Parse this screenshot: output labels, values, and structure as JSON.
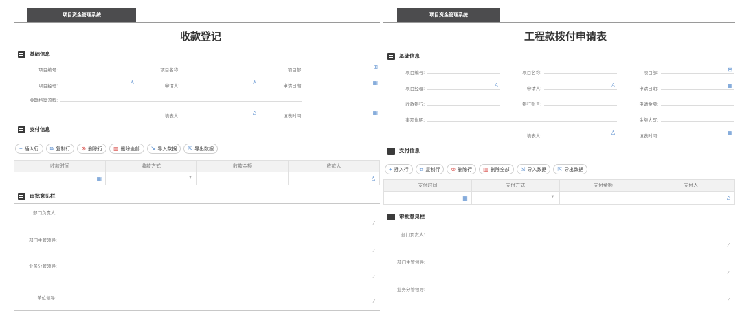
{
  "left": {
    "system_tab": "项目资金管理系统",
    "title": "收款登记",
    "basic_section": "基础信息",
    "fields": {
      "project_no": "项目编号:",
      "project_name": "项目名称:",
      "project_dept": "项目部:",
      "project_manager": "项目经理:",
      "applicant": "申请人:",
      "apply_date": "申请日期:",
      "related_flow": "关联档案流程:",
      "filler": "填表人:",
      "fill_time": "填表时间:"
    },
    "pay_section": "支付信息",
    "toolbar": {
      "insert": "插入行",
      "copy": "复制行",
      "delete": "删除行",
      "delete_all": "删除全部",
      "import": "导入数据",
      "export": "导出数据"
    },
    "columns": [
      "收款时间",
      "收款方式",
      "收款金额",
      "收款人"
    ],
    "opinion_section": "审批意见栏",
    "opinions": [
      "部门负责人:",
      "部门主管领导:",
      "业务分管领导:",
      "单位领导:"
    ]
  },
  "right": {
    "system_tab": "项目资金管理系统",
    "title": "工程款拨付申请表",
    "basic_section": "基础信息",
    "fields": {
      "project_no": "项目编号:",
      "project_name": "项目名称:",
      "project_dept": "项目部:",
      "project_manager": "项目经理:",
      "applicant": "申请人:",
      "apply_date": "申请日期:",
      "receive_bank": "收款银行:",
      "bank_account": "银行账号:",
      "apply_amount": "申请金额:",
      "matter": "事项说明:",
      "amount_upper": "金额大写:",
      "filler": "填表人:",
      "fill_time": "填表时间:"
    },
    "pay_section": "支付信息",
    "toolbar": {
      "insert": "插入行",
      "copy": "复制行",
      "delete": "删除行",
      "delete_all": "删除全部",
      "import": "导入数据",
      "export": "导出数据"
    },
    "columns": [
      "支付时间",
      "支付方式",
      "支付金额",
      "支付人"
    ],
    "opinion_section": "审批意见栏",
    "opinions": [
      "部门负责人:",
      "部门主管领导:",
      "业务分管领导:"
    ]
  },
  "icons": {
    "person": "user-icon",
    "calendar": "calendar-icon",
    "picker": "org-picker-icon"
  },
  "colors": {
    "header_tab": "#4c4c4e",
    "icon_blue": "#5b8fcf",
    "delete_red": "#d9534f"
  }
}
